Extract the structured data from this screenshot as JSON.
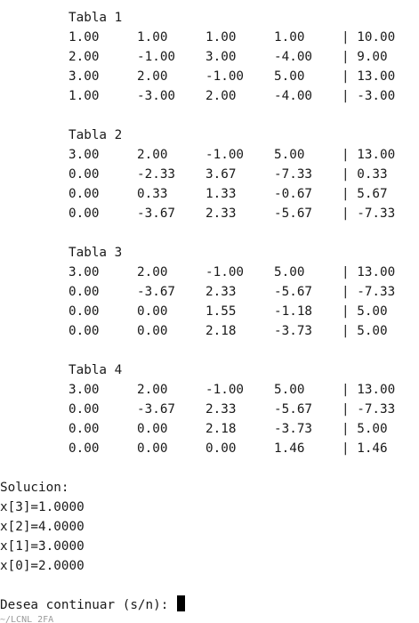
{
  "tables": [
    {
      "title": "Tabla 1",
      "rows": [
        {
          "cells": [
            "1.00",
            "1.00",
            "1.00",
            "1.00"
          ],
          "b": "| 10.00"
        },
        {
          "cells": [
            "2.00",
            "-1.00",
            "3.00",
            "-4.00"
          ],
          "b": "| 9.00"
        },
        {
          "cells": [
            "3.00",
            "2.00",
            "-1.00",
            "5.00"
          ],
          "b": "| 13.00"
        },
        {
          "cells": [
            "1.00",
            "-3.00",
            "2.00",
            "-4.00"
          ],
          "b": "| -3.00"
        }
      ]
    },
    {
      "title": "Tabla 2",
      "rows": [
        {
          "cells": [
            "3.00",
            "2.00",
            "-1.00",
            "5.00"
          ],
          "b": "| 13.00"
        },
        {
          "cells": [
            "0.00",
            "-2.33",
            "3.67",
            "-7.33"
          ],
          "b": "| 0.33"
        },
        {
          "cells": [
            "0.00",
            "0.33",
            "1.33",
            "-0.67"
          ],
          "b": "| 5.67"
        },
        {
          "cells": [
            "0.00",
            "-3.67",
            "2.33",
            "-5.67"
          ],
          "b": "| -7.33"
        }
      ]
    },
    {
      "title": "Tabla 3",
      "rows": [
        {
          "cells": [
            "3.00",
            "2.00",
            "-1.00",
            "5.00"
          ],
          "b": "| 13.00"
        },
        {
          "cells": [
            "0.00",
            "-3.67",
            "2.33",
            "-5.67"
          ],
          "b": "| -7.33"
        },
        {
          "cells": [
            "0.00",
            "0.00",
            "1.55",
            "-1.18"
          ],
          "b": "| 5.00"
        },
        {
          "cells": [
            "0.00",
            "0.00",
            "2.18",
            "-3.73"
          ],
          "b": "| 5.00"
        }
      ]
    },
    {
      "title": "Tabla 4",
      "rows": [
        {
          "cells": [
            "3.00",
            "2.00",
            "-1.00",
            "5.00"
          ],
          "b": "| 13.00"
        },
        {
          "cells": [
            "0.00",
            "-3.67",
            "2.33",
            "-5.67"
          ],
          "b": "| -7.33"
        },
        {
          "cells": [
            "0.00",
            "0.00",
            "2.18",
            "-3.73"
          ],
          "b": "| 5.00"
        },
        {
          "cells": [
            "0.00",
            "0.00",
            "0.00",
            "1.46"
          ],
          "b": "| 1.46"
        }
      ]
    }
  ],
  "solution": {
    "heading": "Solucion:",
    "lines": [
      "x[3]=1.0000",
      "x[2]=4.0000",
      "x[1]=3.0000",
      "x[0]=2.0000"
    ]
  },
  "prompt": {
    "text": "Desea continuar (s/n): "
  },
  "cutoff_text": "~/LCNL_2FA"
}
